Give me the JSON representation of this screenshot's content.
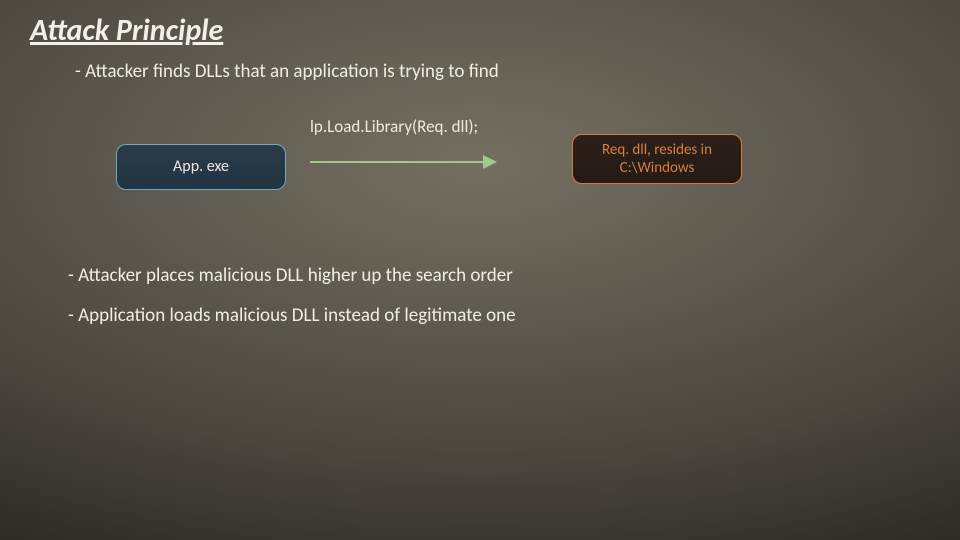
{
  "title": "Attack Principle",
  "bullets": {
    "b1": "- Attacker finds DLLs that an application is trying to find",
    "b2": "- Attacker places malicious DLL higher up the search order",
    "b3": "- Application loads malicious DLL instead of legitimate one"
  },
  "diagram": {
    "left_node": "App. exe",
    "call_label": "lp.Load.Library(Req. dll);",
    "right_node": "Req. dll, resides in C:\\Windows"
  }
}
